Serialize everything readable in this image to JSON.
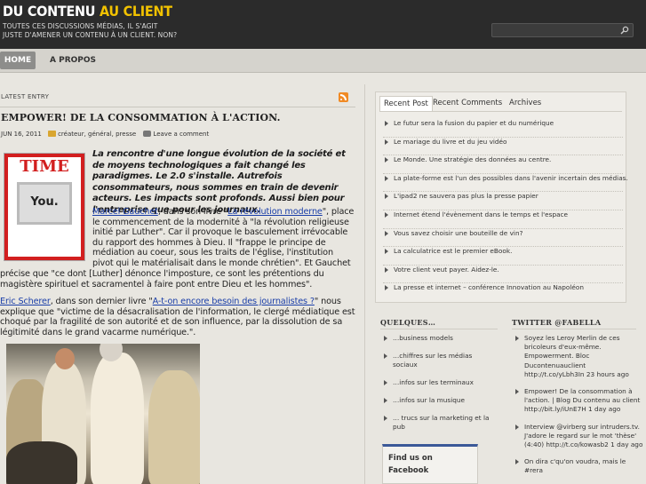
{
  "header": {
    "logo_part1": "DU CONTENU",
    "logo_part2": "AU CLIENT",
    "tagline_line1": "TOUTES CES DISCUSSIONS MÉDIAS, IL S'AGIT",
    "tagline_line2": "JUSTE D'AMENER UN CONTENU À UN CLIENT. NON?",
    "search_value": ""
  },
  "nav": {
    "home": "HOME",
    "about": "A PROPOS"
  },
  "main": {
    "latest_label": "LATEST ENTRY",
    "title": "EMPOWER! DE LA CONSOMMATION À L'ACTION.",
    "date": "JUN 16, 2011",
    "categories": "créateur, général, presse",
    "comment_link": "Leave a comment",
    "cover_title": "TIME",
    "cover_word": "You.",
    "lead": "La rencontre d'une longue évolution de la société et de moyens technologiques a fait changé les paradigmes. Le 2.0 s'installe. Autrefois consommateurs, nous sommes en train de devenir acteurs. Les impacts sont profonds. Aussi bien pour l'entreprise que pour les journaux.",
    "p1_link_author": "Marcel Gauchet",
    "p1_text_a": ", dans son livre \"",
    "p1_link_book": "La révolution moderne",
    "p1_text_b": "\", place le commencement de la modernité à \"la révolution religieuse initié par Luther\". Car il provoque le basculement irrévocable du rapport des hommes à Dieu. Il \"frappe le principe de médiation au coeur, sous les traits de l'église, l'institution pivot qui le matérialisait dans le monde chrétien\". Et Gauchet",
    "p1_text_c": "précise que \"ce dont [Luther] dénonce l'imposture, ce sont les prétentions du magistère spirituel et sacramentel à faire pont entre Dieu et les hommes\".",
    "p2_link_author": "Eric Scherer",
    "p2_text_a": ", dans son dernier livre \"",
    "p2_link_book": "A-t-on encore besoin des journalistes ?",
    "p2_text_b": "\" nous explique que \"victime de la désacralisation de l'information, le clergé médiatique est choqué par la fragilité de son autorité et de son influence, par la dissolution de sa légitimité dans le grand vacarme numérique.\"."
  },
  "sidebar": {
    "tabs": [
      "Recent Post",
      "Recent Comments",
      "Archives"
    ],
    "recent_posts": [
      "Le futur sera la fusion du papier et du numérique",
      "Le mariage du livre et du jeu vidéo",
      "Le Monde. Une stratégie des données au centre.",
      "La plate-forme est l'un des possibles dans l'avenir incertain des médias.",
      "L'ipad2 ne sauvera pas plus la presse papier",
      "Internet étend l'évènement dans le temps et l'espace",
      "Vous savez choisir une bouteille de vin?",
      "La calculatrice est le premier eBook.",
      "Votre client veut payer. Aidez-le.",
      "La presse et internet – conférence Innovation au Napoléon"
    ],
    "quelques_head": "QUELQUES…",
    "categories": [
      "…business models",
      "…chiffres sur les médias sociaux",
      "…infos sur les terminaux",
      "…infos sur la musique",
      "… trucs sur la marketing et la pub"
    ],
    "twitter_head": "TWITTER @FABELLA",
    "tweets": [
      "Soyez les Leroy Merlin de ces bricoleurs d'eux-même. Empowerment. Bloc Ducontenuauclient http://t.co/yLbh3In 23 hours ago",
      "Empower! De la consommation à l'action. | Blog Du contenu au client http://bit.ly/iUnE7H 1 day ago",
      "Interview @virberg sur intruders.tv. J'adore le regard sur le mot 'thèse' (4:40) http://t.co/kowasb2 1 day ago",
      "On dira c'qu'on voudra, mais le #rera"
    ],
    "facebook_title": "Find us on Facebook"
  },
  "colors": {
    "header_bg": "#2b2b2b",
    "logo_accent": "#f2c200",
    "link": "#1a3ea8",
    "page_bg": "#e8e6e0"
  }
}
